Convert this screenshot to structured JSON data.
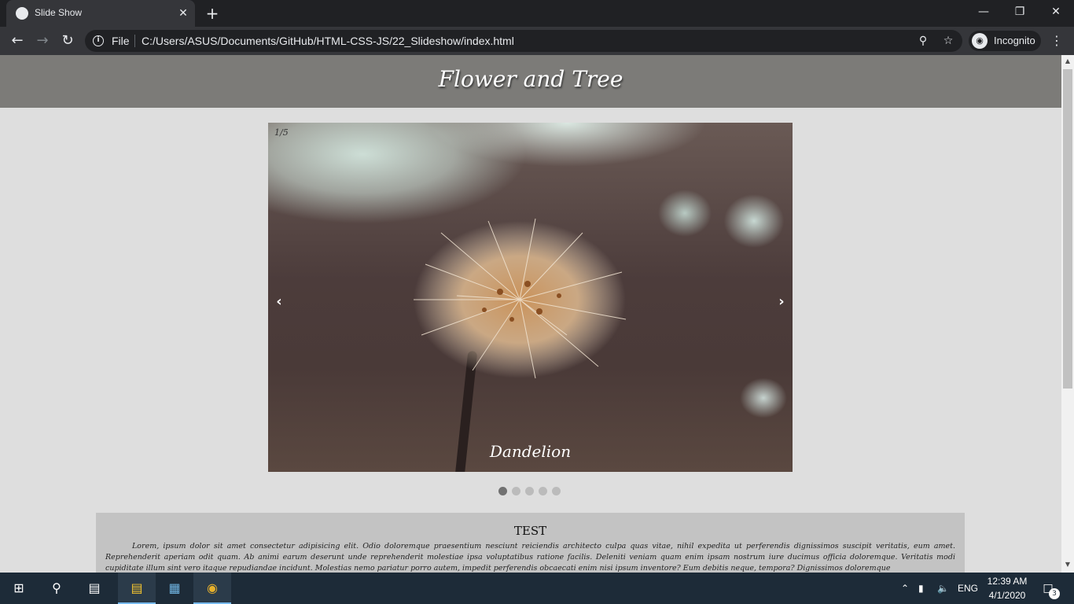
{
  "browser": {
    "tab_title": "Slide Show",
    "tab_close": "✕",
    "new_tab": "+",
    "scheme_label": "File",
    "url": "C:/Users/ASUS/Documents/GitHub/HTML-CSS-JS/22_Slideshow/index.html",
    "incognito_label": "Incognito"
  },
  "page": {
    "title": "Flower and Tree",
    "slideshow": {
      "counter": "1/5",
      "caption": "Dandelion",
      "prev_label": "‹",
      "next_label": "›",
      "slide_count": 5,
      "active_slide": 1
    },
    "section": {
      "heading": "TEST",
      "body": "Lorem, ipsum dolor sit amet consectetur adipisicing elit. Odio doloremque praesentium nesciunt reiciendis architecto culpa quas vitae, nihil expedita ut perferendis dignissimos suscipit veritatis, eum amet. Reprehenderit aperiam odit quam. Ab animi earum deserunt unde reprehenderit molestiae ipsa voluptatibus ratione facilis. Deleniti veniam quam enim ipsam nostrum iure ducimus officia doloremque. Veritatis modi cupiditate illum sint vero itaque repudiandae incidunt. Molestias nemo pariatur porro autem, impedit perferendis obcaecati enim nisi ipsum inventore? Eum debitis neque, tempora? Dignissimos doloremque"
    }
  },
  "taskbar": {
    "language": "ENG",
    "time": "12:39 AM",
    "date": "4/1/2020",
    "notification_count": "3"
  },
  "colors": {
    "header_bg": "#7c7b78",
    "page_bg": "#dedede",
    "text_section_bg": "#c3c3c3",
    "dot_active": "#717171",
    "dot_inactive": "#bbbbbb"
  }
}
